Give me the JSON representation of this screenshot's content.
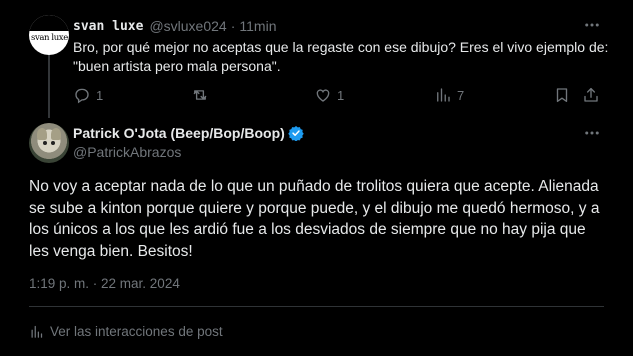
{
  "reply": {
    "display_name": "svan luxe",
    "avatar_text": "svan luxe",
    "handle": "@svluxe024",
    "separator": "·",
    "time": "11min",
    "text": "Bro, por qué mejor no aceptas que la regaste con ese dibujo? Eres el vivo ejemplo de: \"buen artista pero mala persona\".",
    "actions": {
      "replies": "1",
      "reposts": "",
      "likes": "1",
      "views": "7"
    }
  },
  "tweet": {
    "display_name": "Patrick O'Jota (Beep/Bop/Boop)",
    "handle": "@PatrickAbrazos",
    "verified": true,
    "text": "No voy a aceptar nada de lo que un puñado de trolitos quiera que acepte. Alienada se sube a kinton porque quiere y porque puede, y el dibujo me quedó hermoso, y a los únicos a los que les ardió fue a los desviados de siempre que no hay pija que les venga bien. Besitos!",
    "timestamp": "1:19 p. m. · 22 mar. 2024",
    "view_interactions": "Ver las interacciones de post"
  },
  "colors": {
    "background": "#000000",
    "text_primary": "#e7e9ea",
    "text_secondary": "#71767b",
    "verified_blue": "#1d9bf0",
    "divider": "#2f3336"
  },
  "icons": [
    "more-icon",
    "reply-icon",
    "repost-icon",
    "like-icon",
    "views-icon",
    "bookmark-icon",
    "share-icon",
    "verified-badge-icon",
    "analytics-icon"
  ]
}
